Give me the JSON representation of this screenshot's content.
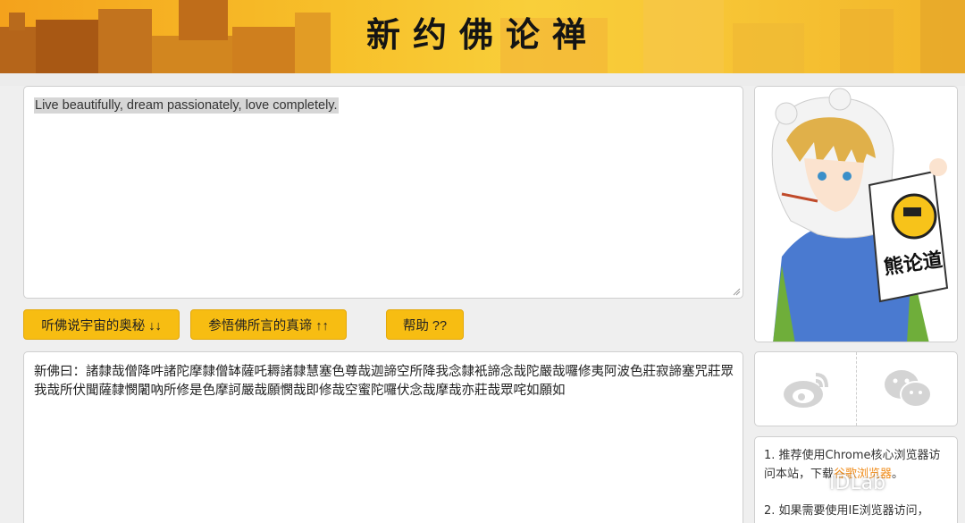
{
  "header": {
    "title": "新约佛论禅"
  },
  "input": {
    "text": "Live beautifully, dream passionately, love completely."
  },
  "buttons": {
    "encode": "听佛说宇宙的奥秘 ↓↓",
    "decode": "参悟佛所言的真谛 ↑↑",
    "help": "帮助 ??"
  },
  "output": {
    "text": "新佛曰：諸隸哉僧降吽諸陀摩隸僧缽薩吒耨諸隸慧塞色尊哉迦諦空所降我念隸衹諦念哉陀嚴哉囉修夷阿波色莊寂諦塞咒莊眾我哉所伏聞薩隸憫闍吶所修是色摩訶嚴哉願憫哉即修哉空蜜陀囉伏念哉摩哉亦莊哉眾咤如願如"
  },
  "avatar": {
    "badge_text": "熊论道"
  },
  "social": {
    "left_icon": "weibo-icon",
    "right_icon": "wechat-icon"
  },
  "tips": {
    "tip1_prefix": "1. 推荐使用Chrome核心浏览器访问本站，下载",
    "tip1_link": "谷歌浏览器",
    "tip1_suffix": "。",
    "tip2": "2. 如果需要使用IE浏览器访问，"
  },
  "watermark": {
    "text": "IDLab"
  },
  "colors": {
    "button": "#f7bd12",
    "banner": "#f7c02a",
    "link": "#f08c1a"
  }
}
